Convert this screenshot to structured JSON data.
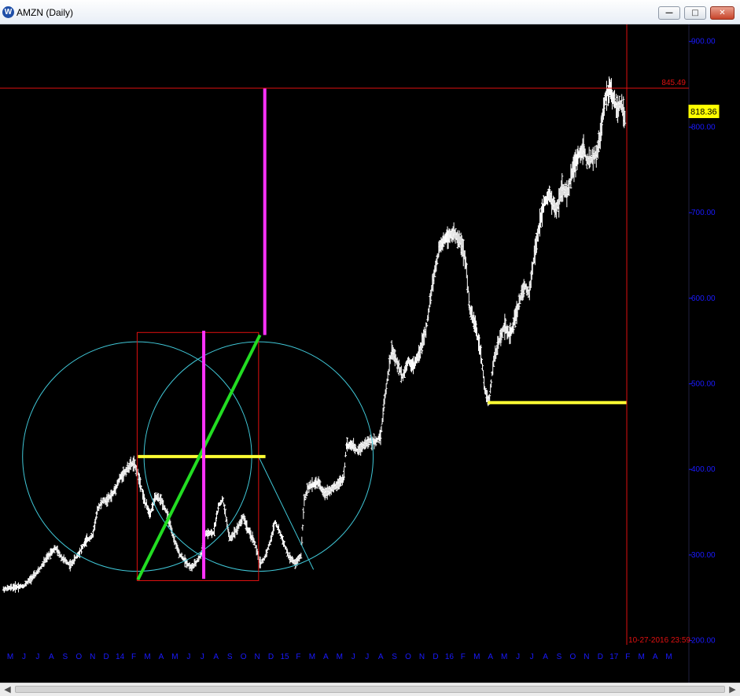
{
  "window": {
    "title": "AMZN (Daily)",
    "icon": "W",
    "minimize_glyph": "—",
    "maximize_glyph": "□",
    "close_glyph": "✕"
  },
  "scrollbar": {
    "left_glyph": "◀",
    "right_glyph": "▶"
  },
  "chart_data": {
    "type": "bar",
    "symbol": "AMZN",
    "interval": "Daily",
    "background": "#000000",
    "price_color": "#ffffff",
    "axis_label_color": "#1a1aff",
    "accent_red": "#e01010",
    "ylim": [
      195,
      920
    ],
    "yticks": [
      "200.00",
      "300.00",
      "400.00",
      "500.00",
      "600.00",
      "700.00",
      "800.00",
      "900.00"
    ],
    "xlim": [
      0,
      42.5
    ],
    "xticks": [
      {
        "i": 0,
        "label": "M"
      },
      {
        "i": 1,
        "label": "J"
      },
      {
        "i": 2,
        "label": "J"
      },
      {
        "i": 3,
        "label": "A"
      },
      {
        "i": 4,
        "label": "S"
      },
      {
        "i": 5,
        "label": "O"
      },
      {
        "i": 6,
        "label": "N"
      },
      {
        "i": 7,
        "label": "D"
      },
      {
        "i": 8,
        "label": "14"
      },
      {
        "i": 9,
        "label": "F"
      },
      {
        "i": 10,
        "label": "M"
      },
      {
        "i": 11,
        "label": "A"
      },
      {
        "i": 12,
        "label": "M"
      },
      {
        "i": 13,
        "label": "J"
      },
      {
        "i": 14,
        "label": "J"
      },
      {
        "i": 15,
        "label": "A"
      },
      {
        "i": 16,
        "label": "S"
      },
      {
        "i": 17,
        "label": "O"
      },
      {
        "i": 18,
        "label": "N"
      },
      {
        "i": 19,
        "label": "D"
      },
      {
        "i": 20,
        "label": "15"
      },
      {
        "i": 21,
        "label": "F"
      },
      {
        "i": 22,
        "label": "M"
      },
      {
        "i": 23,
        "label": "A"
      },
      {
        "i": 24,
        "label": "M"
      },
      {
        "i": 25,
        "label": "J"
      },
      {
        "i": 26,
        "label": "J"
      },
      {
        "i": 27,
        "label": "A"
      },
      {
        "i": 28,
        "label": "S"
      },
      {
        "i": 29,
        "label": "O"
      },
      {
        "i": 30,
        "label": "N"
      },
      {
        "i": 31,
        "label": "D"
      },
      {
        "i": 32,
        "label": "16"
      },
      {
        "i": 33,
        "label": "F"
      },
      {
        "i": 34,
        "label": "M"
      },
      {
        "i": 35,
        "label": "A"
      },
      {
        "i": 36,
        "label": "M"
      },
      {
        "i": 37,
        "label": "J"
      },
      {
        "i": 38,
        "label": "J"
      },
      {
        "i": 39,
        "label": "A"
      },
      {
        "i": 40,
        "label": "S"
      },
      {
        "i": 41,
        "label": "O"
      },
      {
        "i": 42,
        "label": "N"
      },
      {
        "i": 43,
        "label": "D"
      },
      {
        "i": 44,
        "label": "17"
      },
      {
        "i": 45,
        "label": "F"
      },
      {
        "i": 46,
        "label": "M"
      },
      {
        "i": 47,
        "label": "A"
      },
      {
        "i": 48,
        "label": "M"
      }
    ],
    "price_path": [
      [
        -0.5,
        260
      ],
      [
        0.2,
        262
      ],
      [
        1.0,
        264
      ],
      [
        2.0,
        280
      ],
      [
        3.0,
        304
      ],
      [
        3.3,
        308
      ],
      [
        3.8,
        296
      ],
      [
        4.4,
        288
      ],
      [
        5.0,
        302
      ],
      [
        5.6,
        318
      ],
      [
        6.0,
        322
      ],
      [
        6.4,
        355
      ],
      [
        6.8,
        364
      ],
      [
        7.0,
        363
      ],
      [
        7.5,
        372
      ],
      [
        8.0,
        390
      ],
      [
        8.4,
        398
      ],
      [
        8.8,
        406
      ],
      [
        9.0,
        407
      ],
      [
        9.3,
        396
      ],
      [
        9.8,
        362
      ],
      [
        10.2,
        348
      ],
      [
        10.6,
        368
      ],
      [
        11.0,
        364
      ],
      [
        11.4,
        350
      ],
      [
        11.8,
        325
      ],
      [
        12.3,
        302
      ],
      [
        12.8,
        292
      ],
      [
        13.2,
        285
      ],
      [
        13.5,
        290
      ],
      [
        13.9,
        300
      ],
      [
        14.2,
        325
      ],
      [
        14.8,
        325
      ],
      [
        15.2,
        358
      ],
      [
        15.5,
        365
      ],
      [
        16.0,
        318
      ],
      [
        16.5,
        330
      ],
      [
        17.0,
        345
      ],
      [
        17.3,
        330
      ],
      [
        17.8,
        315
      ],
      [
        18.2,
        290
      ],
      [
        18.5,
        295
      ],
      [
        19.0,
        318
      ],
      [
        19.3,
        340
      ],
      [
        19.8,
        320
      ],
      [
        20.3,
        298
      ],
      [
        20.8,
        290
      ],
      [
        21.2,
        300
      ],
      [
        21.4,
        362
      ],
      [
        21.7,
        378
      ],
      [
        22.0,
        382
      ],
      [
        22.5,
        385
      ],
      [
        22.8,
        372
      ],
      [
        23.3,
        376
      ],
      [
        23.7,
        380
      ],
      [
        24.3,
        390
      ],
      [
        24.5,
        428
      ],
      [
        24.9,
        428
      ],
      [
        25.3,
        422
      ],
      [
        25.7,
        428
      ],
      [
        26.2,
        433
      ],
      [
        26.6,
        432
      ],
      [
        27.0,
        440
      ],
      [
        27.3,
        485
      ],
      [
        27.8,
        540
      ],
      [
        28.3,
        520
      ],
      [
        28.6,
        508
      ],
      [
        29.0,
        528
      ],
      [
        29.4,
        520
      ],
      [
        29.8,
        536
      ],
      [
        30.3,
        562
      ],
      [
        30.8,
        620
      ],
      [
        31.3,
        660
      ],
      [
        31.8,
        672
      ],
      [
        32.3,
        675
      ],
      [
        32.8,
        668
      ],
      [
        33.2,
        642
      ],
      [
        33.5,
        585
      ],
      [
        33.9,
        568
      ],
      [
        34.3,
        535
      ],
      [
        34.6,
        492
      ],
      [
        34.9,
        478
      ],
      [
        35.2,
        525
      ],
      [
        35.6,
        548
      ],
      [
        36.0,
        568
      ],
      [
        36.4,
        555
      ],
      [
        36.8,
        578
      ],
      [
        37.2,
        602
      ],
      [
        37.5,
        615
      ],
      [
        37.8,
        605
      ],
      [
        38.0,
        628
      ],
      [
        38.3,
        662
      ],
      [
        38.6,
        688
      ],
      [
        38.9,
        712
      ],
      [
        39.3,
        720
      ],
      [
        39.8,
        702
      ],
      [
        40.2,
        728
      ],
      [
        40.6,
        722
      ],
      [
        41.0,
        752
      ],
      [
        41.4,
        768
      ],
      [
        41.8,
        775
      ],
      [
        42.0,
        762
      ],
      [
        42.4,
        762
      ],
      [
        42.8,
        770
      ],
      [
        43.1,
        802
      ],
      [
        43.4,
        838
      ],
      [
        43.7,
        843
      ],
      [
        44.0,
        832
      ],
      [
        44.2,
        820
      ],
      [
        44.5,
        828
      ],
      [
        44.8,
        810
      ]
    ],
    "last_price": "818.36",
    "last_price_value": 818.36,
    "high_value": 845.49,
    "crosshair": {
      "x": 44.93,
      "y": 845.49,
      "price_label": "845.49",
      "time_label": "10-27-2016 23:59"
    },
    "annotations": {
      "circles": [
        {
          "cx": 9.25,
          "cy": 415,
          "r_x": 8.35
        },
        {
          "cx": 18.1,
          "cy": 415,
          "r_x": 8.35
        }
      ],
      "rectangle": {
        "x0": 9.25,
        "x1": 18.1,
        "y0": 270,
        "y1": 560
      },
      "green_line": {
        "x0": 9.3,
        "y0": 271,
        "x1": 18.2,
        "y1": 557
      },
      "magenta_lines": [
        {
          "x": 14.1,
          "y0": 272,
          "y1": 562
        },
        {
          "x": 18.55,
          "y0": 557,
          "y1": 845
        }
      ],
      "yellow_lines": [
        {
          "x0": 9.3,
          "x1": 18.6,
          "y": 415
        },
        {
          "x0": 34.8,
          "x1": 44.95,
          "y": 478
        }
      ],
      "fan_line": {
        "x0": 18.1,
        "y0": 415,
        "x1": 22.1,
        "y1": 283
      }
    }
  }
}
